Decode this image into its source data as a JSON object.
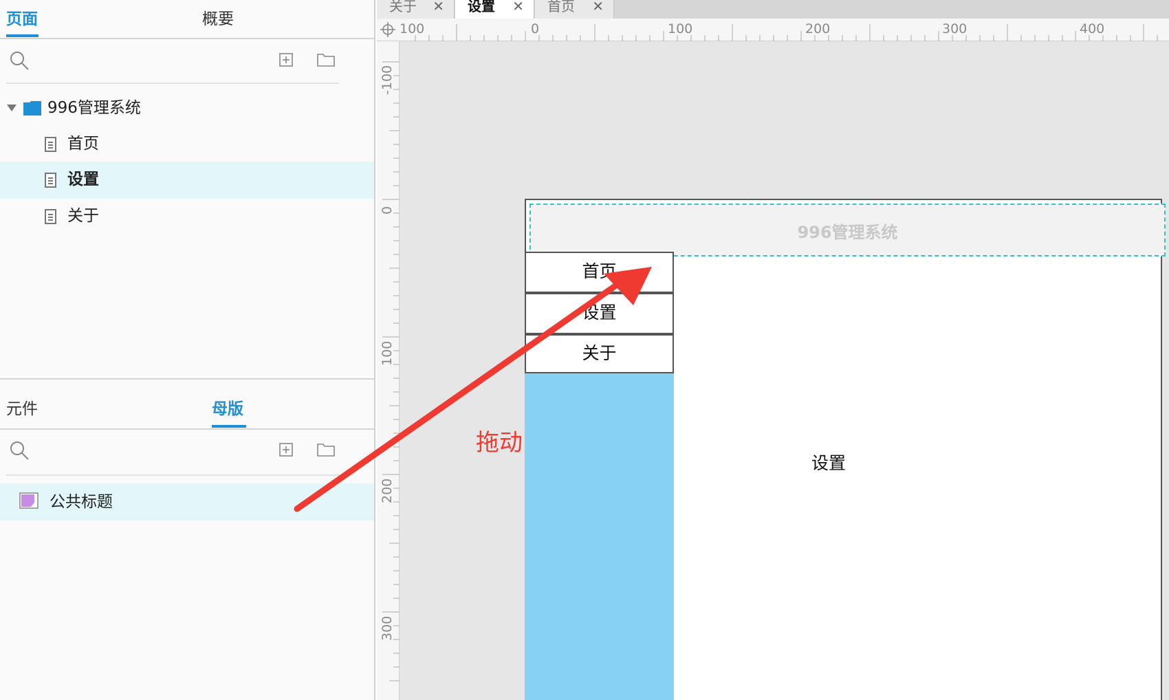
{
  "pages_panel": {
    "tabs": [
      {
        "label": "页面",
        "active": true
      },
      {
        "label": "概要",
        "active": false
      }
    ],
    "tree": {
      "folder": "996管理系统",
      "pages": [
        {
          "label": "首页",
          "selected": false
        },
        {
          "label": "设置",
          "selected": true
        },
        {
          "label": "关于",
          "selected": false
        }
      ]
    }
  },
  "masters_panel": {
    "tabs": [
      {
        "label": "元件",
        "active": false
      },
      {
        "label": "母版",
        "active": true
      }
    ],
    "items": [
      {
        "label": "公共标题",
        "selected": true
      }
    ]
  },
  "doc_tabs": [
    {
      "label": "关于",
      "active": false
    },
    {
      "label": "设置",
      "active": true
    },
    {
      "label": "首页",
      "active": false
    }
  ],
  "ruler_top": [
    "100",
    "0",
    "100",
    "200",
    "300",
    "400"
  ],
  "ruler_left": [
    "-100",
    "0",
    "100",
    "200",
    "300"
  ],
  "canvas": {
    "master_header_title": "996管理系统",
    "nav_items": [
      "首页",
      "设置",
      "关于"
    ],
    "content_label": "设置",
    "annotation": "拖动"
  },
  "colors": {
    "accent": "#1f8fd6",
    "selection": "#e3f7fa",
    "sidebar_fill": "#85d2f5",
    "master_icon": "#c98ce6",
    "annotation": "#ee3a30"
  }
}
